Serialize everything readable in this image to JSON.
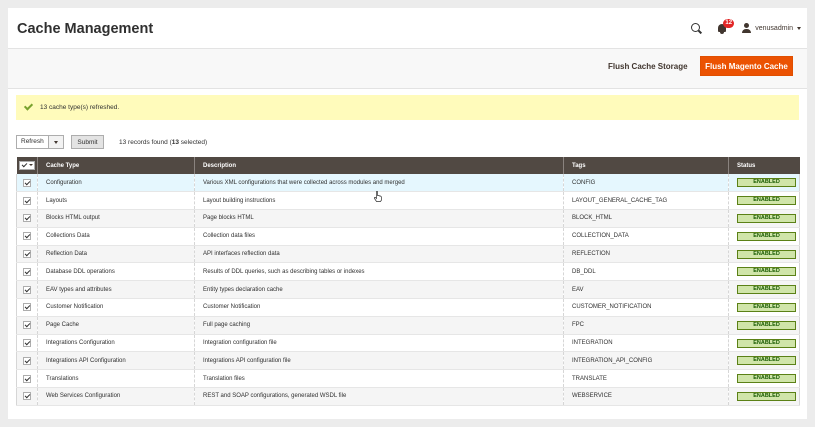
{
  "page": {
    "title": "Cache Management"
  },
  "header": {
    "notification_count": "12",
    "username": "venusadmin"
  },
  "actions": {
    "flush_cache_storage": "Flush Cache Storage",
    "flush_magento_cache": "Flush Magento Cache"
  },
  "message": {
    "text": "13 cache type(s) refreshed."
  },
  "toolbar": {
    "mass_action_value": "Refresh",
    "submit_label": "Submit",
    "records_prefix": "13 records found (",
    "records_selected": "13",
    "records_suffix": " selected)"
  },
  "grid": {
    "columns": [
      "Cache Type",
      "Description",
      "Tags",
      "Status"
    ],
    "rows": [
      {
        "type": "Configuration",
        "description": "Various XML configurations that were collected across modules and merged",
        "tags": "CONFIG",
        "status": "ENABLED"
      },
      {
        "type": "Layouts",
        "description": "Layout building instructions",
        "tags": "LAYOUT_GENERAL_CACHE_TAG",
        "status": "ENABLED"
      },
      {
        "type": "Blocks HTML output",
        "description": "Page blocks HTML",
        "tags": "BLOCK_HTML",
        "status": "ENABLED"
      },
      {
        "type": "Collections Data",
        "description": "Collection data files",
        "tags": "COLLECTION_DATA",
        "status": "ENABLED"
      },
      {
        "type": "Reflection Data",
        "description": "API interfaces reflection data",
        "tags": "REFLECTION",
        "status": "ENABLED"
      },
      {
        "type": "Database DDL operations",
        "description": "Results of DDL queries, such as describing tables or indexes",
        "tags": "DB_DDL",
        "status": "ENABLED"
      },
      {
        "type": "EAV types and attributes",
        "description": "Entity types declaration cache",
        "tags": "EAV",
        "status": "ENABLED"
      },
      {
        "type": "Customer Notification",
        "description": "Customer Notification",
        "tags": "CUSTOMER_NOTIFICATION",
        "status": "ENABLED"
      },
      {
        "type": "Page Cache",
        "description": "Full page caching",
        "tags": "FPC",
        "status": "ENABLED"
      },
      {
        "type": "Integrations Configuration",
        "description": "Integration configuration file",
        "tags": "INTEGRATION",
        "status": "ENABLED"
      },
      {
        "type": "Integrations API Configuration",
        "description": "Integrations API configuration file",
        "tags": "INTEGRATION_API_CONFIG",
        "status": "ENABLED"
      },
      {
        "type": "Translations",
        "description": "Translation files",
        "tags": "TRANSLATE",
        "status": "ENABLED"
      },
      {
        "type": "Web Services Configuration",
        "description": "REST and SOAP configurations, generated WSDL file",
        "tags": "WEBSERVICE",
        "status": "ENABLED"
      }
    ]
  },
  "colors": {
    "accent": "#eb5202",
    "header_bg": "#514943",
    "message_bg": "#fffbbb",
    "status_bg": "#d0e5a9"
  },
  "icons": [
    "search-icon",
    "bell-icon",
    "user-icon",
    "check-icon",
    "chevron-down-icon"
  ]
}
